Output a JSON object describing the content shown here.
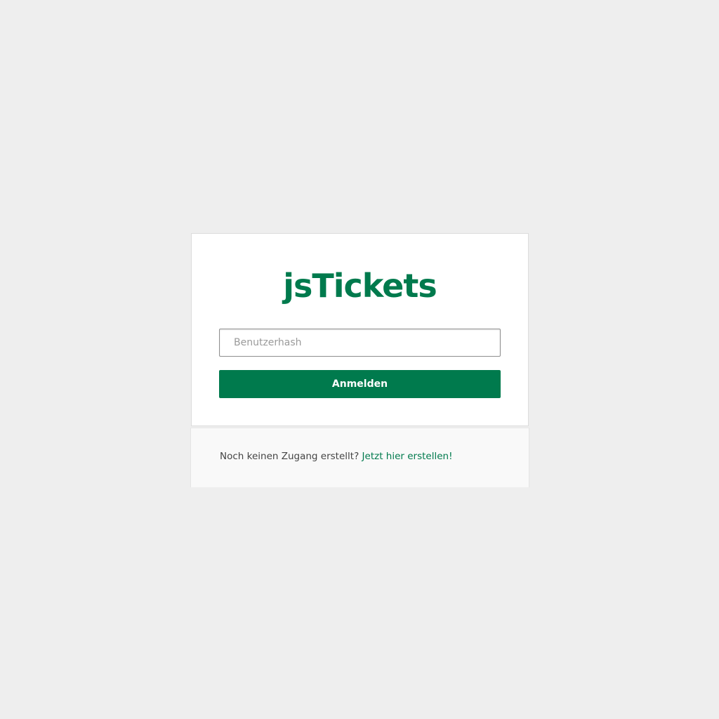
{
  "app": {
    "title": "jsTickets"
  },
  "login": {
    "input_placeholder": "Benutzerhash",
    "input_value": "",
    "button_label": "Anmelden"
  },
  "footer": {
    "prompt": "Noch keinen Zugang erstellt?",
    "link_label": "Jetzt hier erstellen!"
  },
  "colors": {
    "brand": "#007a4d",
    "page_background": "#eeeeee",
    "card_background": "#ffffff",
    "footer_background": "#f9f9f9"
  }
}
